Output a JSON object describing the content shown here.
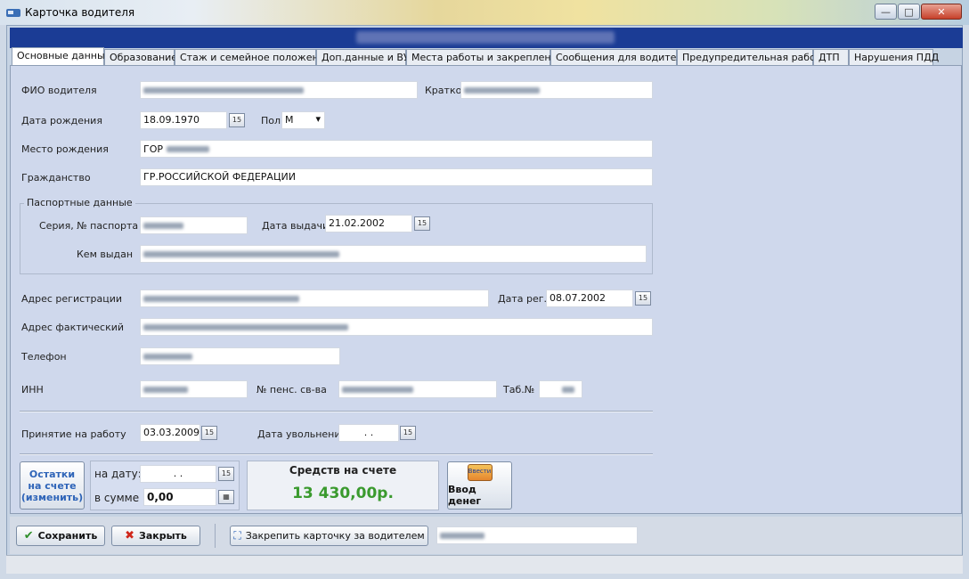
{
  "window": {
    "title": "Карточка водителя",
    "minimize_glyph": "—",
    "maximize_glyph": "□",
    "close_glyph": "✕"
  },
  "tabs": [
    {
      "label": "Основные данные",
      "active": true
    },
    {
      "label": "Образование"
    },
    {
      "label": "Стаж и семейное положение"
    },
    {
      "label": "Доп.данные и ВУ"
    },
    {
      "label": "Места работы и закрепления"
    },
    {
      "label": "Сообщения для водителя"
    },
    {
      "label": "Предупредительная работа"
    },
    {
      "label": "ДТП"
    },
    {
      "label": "Нарушения ПДД"
    }
  ],
  "form": {
    "fio_label": "ФИО водителя",
    "short_label": "Кратко",
    "birth_date_label": "Дата рождения",
    "birth_date": "18.09.1970",
    "gender_label": "Пол",
    "gender": "М",
    "birth_place_label": "Место рождения",
    "birth_place_prefix": "ГОР",
    "citizenship_label": "Гражданство",
    "citizenship": "ГР.РОССИЙСКОЙ ФЕДЕРАЦИИ",
    "passport_group_label": "Паспортные данные",
    "passport_series_label": "Серия, № паспорта",
    "issue_date_label": "Дата выдачи",
    "issue_date": "21.02.2002",
    "issued_by_label": "Кем выдан",
    "reg_address_label": "Адрес регистрации",
    "reg_date_label": "Дата рег.",
    "reg_date": "08.07.2002",
    "actual_address_label": "Адрес фактический",
    "phone_label": "Телефон",
    "inn_label": "ИНН",
    "pension_label": "№ пенс. св-ва",
    "tab_no_label": "Таб.№",
    "hire_date_label": "Принятие на работу",
    "hire_date": "03.03.2009",
    "dismissal_label": "Дата увольнения",
    "dismissal_date": ". ."
  },
  "balance": {
    "edit_button": "Остатки на счете (изменить)",
    "on_date_label": "на дату:",
    "on_date_value": ". .",
    "sum_label": "в сумме",
    "sum_value": "0,00",
    "funds_title": "Средств на счете",
    "funds_value": "13 430,00р.",
    "deposit_icon_text": "Ввести",
    "deposit_button": "Ввод денег"
  },
  "actions": {
    "save": "Сохранить",
    "close": "Закрыть",
    "assign": "Закрепить карточку за водителем"
  },
  "colors": {
    "header_band": "#1b3c95",
    "funds_value": "#3a9a2e",
    "link_blue": "#2e64b8"
  }
}
